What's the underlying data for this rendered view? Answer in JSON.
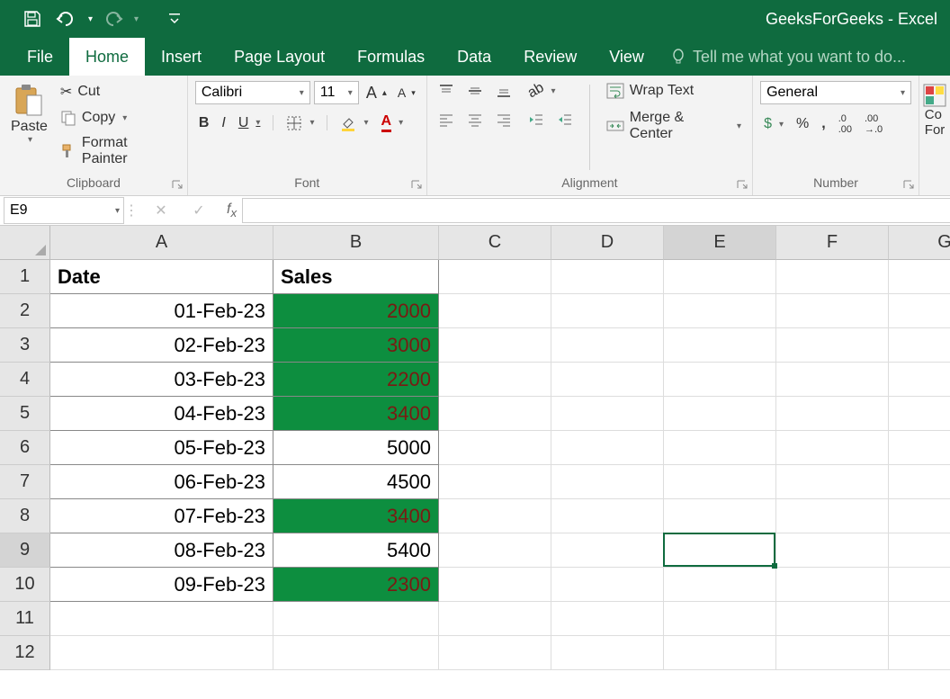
{
  "app": {
    "title": "GeeksForGeeks - Excel"
  },
  "tabs": [
    "File",
    "Home",
    "Insert",
    "Page Layout",
    "Formulas",
    "Data",
    "Review",
    "View"
  ],
  "activeTab": 1,
  "tellme": "Tell me what you want to do...",
  "clipboard": {
    "paste": "Paste",
    "cut": "Cut",
    "copy": "Copy",
    "format_painter": "Format Painter",
    "label": "Clipboard"
  },
  "font": {
    "name": "Calibri",
    "size": "11",
    "label": "Font"
  },
  "alignment": {
    "wrap": "Wrap Text",
    "merge": "Merge & Center",
    "label": "Alignment"
  },
  "number": {
    "format": "General",
    "label": "Number"
  },
  "namebox": "E9",
  "formula": "",
  "columns": [
    "A",
    "B",
    "C",
    "D",
    "E",
    "F",
    "G"
  ],
  "selectedCell": {
    "col": 4,
    "row": 9
  },
  "rows": [
    {
      "n": 1,
      "A": "Date",
      "B": "Sales",
      "header": true
    },
    {
      "n": 2,
      "A": "01-Feb-23",
      "B": "2000",
      "hl": true
    },
    {
      "n": 3,
      "A": "02-Feb-23",
      "B": "3000",
      "hl": true
    },
    {
      "n": 4,
      "A": "03-Feb-23",
      "B": "2200",
      "hl": true
    },
    {
      "n": 5,
      "A": "04-Feb-23",
      "B": "3400",
      "hl": true
    },
    {
      "n": 6,
      "A": "05-Feb-23",
      "B": "5000",
      "hl": false
    },
    {
      "n": 7,
      "A": "06-Feb-23",
      "B": "4500",
      "hl": false
    },
    {
      "n": 8,
      "A": "07-Feb-23",
      "B": "3400",
      "hl": true
    },
    {
      "n": 9,
      "A": "08-Feb-23",
      "B": "5400",
      "hl": false
    },
    {
      "n": 10,
      "A": "09-Feb-23",
      "B": "2300",
      "hl": true
    },
    {
      "n": 11,
      "A": "",
      "B": ""
    },
    {
      "n": 12,
      "A": "",
      "B": ""
    }
  ],
  "cond_label": "Co\nFor"
}
